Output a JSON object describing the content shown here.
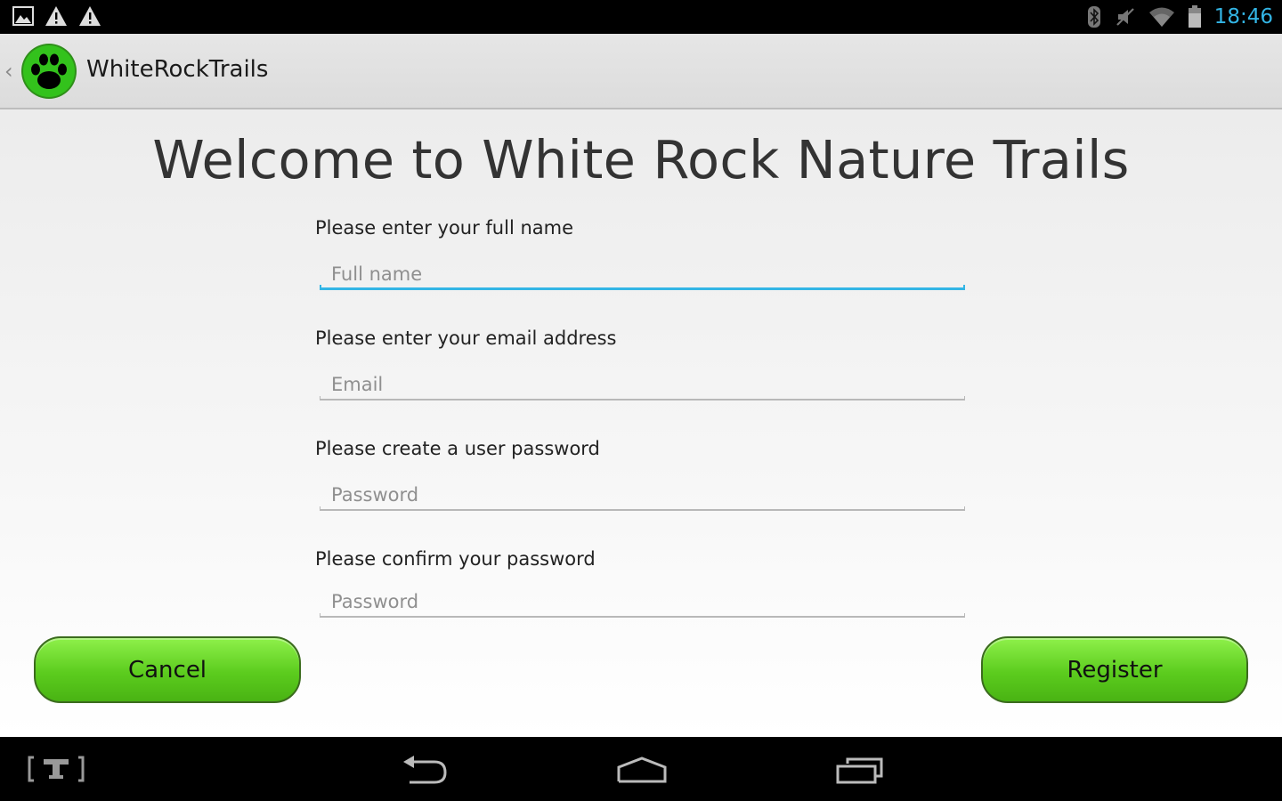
{
  "status_bar": {
    "time": "18:46",
    "time_color": "#33b5e5",
    "left_icons": [
      "image-notification-icon",
      "warning-icon",
      "warning-icon"
    ],
    "right_icons": [
      "bluetooth-icon",
      "mute-icon",
      "wifi-icon",
      "battery-icon"
    ]
  },
  "action_bar": {
    "title": "WhiteRockTrails",
    "icon": "paw-icon"
  },
  "main": {
    "welcome": "Welcome to White Rock Nature Trails",
    "fields": [
      {
        "label": "Please enter your full name",
        "placeholder": "Full name",
        "value": ""
      },
      {
        "label": "Please enter your email address",
        "placeholder": "Email",
        "value": ""
      },
      {
        "label": "Please create a user password",
        "placeholder": "Password",
        "value": ""
      },
      {
        "label": "Please confirm your password",
        "placeholder": "Password",
        "value": ""
      }
    ],
    "cancel_label": "Cancel",
    "register_label": "Register",
    "accent_color": "#33b5e5",
    "button_color": "#5ccc1e"
  },
  "nav_bar": {
    "items": [
      "app-shortcut-t-icon",
      "back-icon",
      "home-icon",
      "recent-apps-icon"
    ]
  }
}
